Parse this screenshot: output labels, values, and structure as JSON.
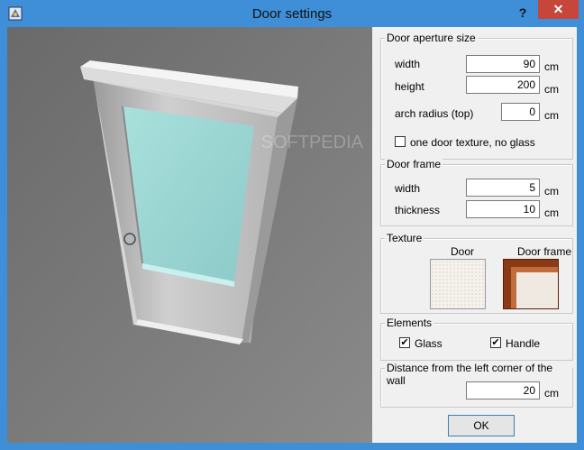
{
  "window": {
    "title": "Door settings",
    "help": "?",
    "close": "✕"
  },
  "aperture": {
    "legend": "Door aperture size",
    "width_label": "width",
    "width_value": "90",
    "width_unit": "cm",
    "height_label": "height",
    "height_value": "200",
    "height_unit": "cm",
    "arch_label": "arch radius (top)",
    "arch_value": "0",
    "arch_unit": "cm",
    "one_texture_label": "one door texture, no glass",
    "one_texture_checked": false
  },
  "frame": {
    "legend": "Door frame",
    "width_label": "width",
    "width_value": "5",
    "width_unit": "cm",
    "thickness_label": "thickness",
    "thickness_value": "10",
    "thickness_unit": "cm"
  },
  "texture": {
    "legend": "Texture",
    "door_label": "Door",
    "frame_label": "Door frame"
  },
  "elements": {
    "legend": "Elements",
    "glass_label": "Glass",
    "glass_checked": true,
    "handle_label": "Handle",
    "handle_checked": true,
    "check_mark": "✔"
  },
  "distance": {
    "legend": "Distance from the left corner of the wall",
    "value": "20",
    "unit": "cm"
  },
  "buttons": {
    "ok": "OK"
  },
  "watermark": "SOFTPEDIA",
  "colors": {
    "titlebar": "#3f8fd8",
    "viewport": "#7a7a7a",
    "glass": "#9fd6d4",
    "frame_wood": "#8b3a16"
  }
}
